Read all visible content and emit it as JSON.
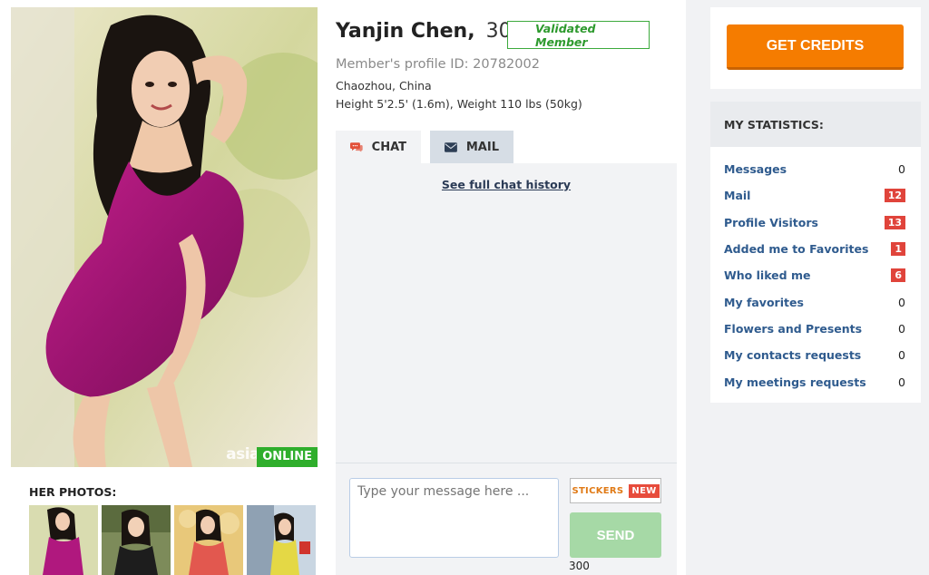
{
  "profile": {
    "name": "Yanjin Chen,",
    "age": "30",
    "validated_label": "Validated Member",
    "profile_id": "Member's profile ID: 20782002",
    "location": "Chaozhou, China",
    "height_weight": "Height 5'2.5' (1.6m), Weight 110 lbs (50kg)",
    "status": "ONLINE",
    "watermark": "asia"
  },
  "photos": {
    "title": "HER PHOTOS:"
  },
  "tabs": [
    {
      "label": "CHAT",
      "icon": "chat-bubble-icon"
    },
    {
      "label": "MAIL",
      "icon": "envelope-icon"
    }
  ],
  "chat": {
    "history_link": "See full chat history",
    "input_placeholder": "Type your message here ...",
    "stickers_label": "STICKERS",
    "new_badge": "NEW",
    "send_label": "SEND",
    "char_count": "300"
  },
  "credits": {
    "button_label": "GET CREDITS"
  },
  "stats": {
    "title": "MY STATISTICS:",
    "items": [
      {
        "label": "Messages",
        "value": "0",
        "highlight": false
      },
      {
        "label": "Mail",
        "value": "12",
        "highlight": true
      },
      {
        "label": "Profile Visitors",
        "value": "13",
        "highlight": true
      },
      {
        "label": "Added me to Favorites",
        "value": "1",
        "highlight": true
      },
      {
        "label": "Who liked me",
        "value": "6",
        "highlight": true
      },
      {
        "label": "My favorites",
        "value": "0",
        "highlight": false
      },
      {
        "label": "Flowers and Presents",
        "value": "0",
        "highlight": false
      },
      {
        "label": "My contacts requests",
        "value": "0",
        "highlight": false
      },
      {
        "label": "My meetings requests",
        "value": "0",
        "highlight": false
      }
    ]
  },
  "colors": {
    "accent_orange": "#f57c00",
    "online_green": "#2fae2c",
    "badge_red": "#e0443b",
    "link_blue": "#2f5b8e"
  }
}
